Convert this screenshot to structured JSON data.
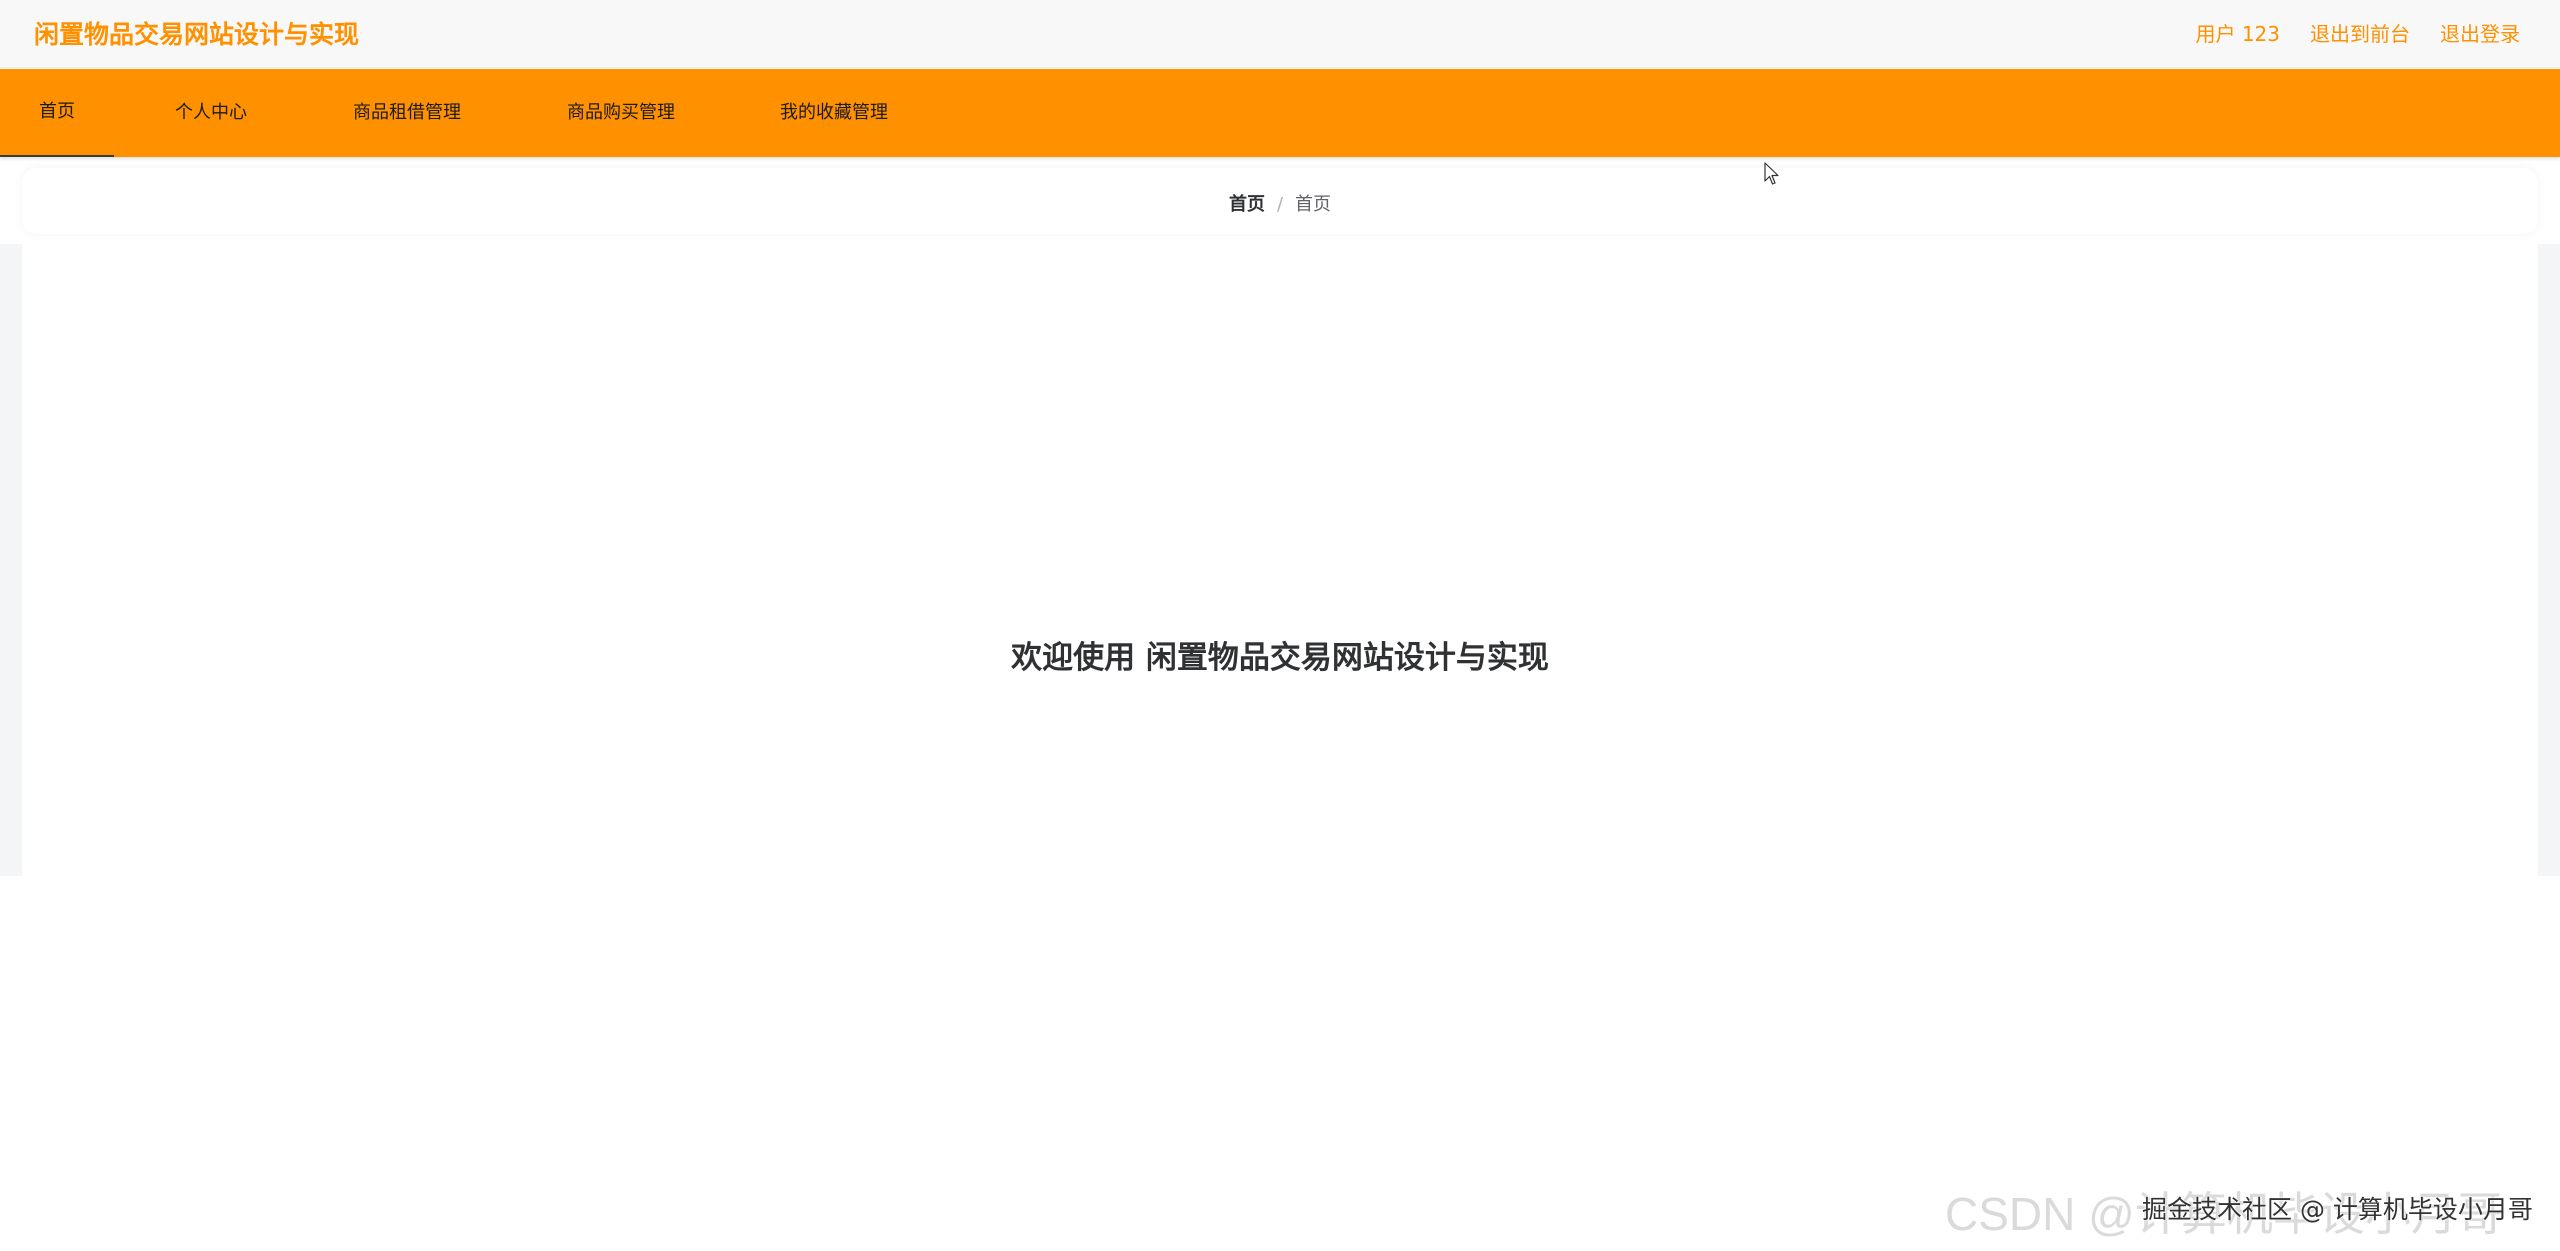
{
  "header": {
    "site_title": "闲置物品交易网站设计与实现",
    "user_label": "用户 123",
    "back_to_front": "退出到前台",
    "logout": "退出登录"
  },
  "nav": {
    "items": [
      {
        "label": "首页",
        "active": true
      },
      {
        "label": "个人中心"
      },
      {
        "label": "商品租借管理"
      },
      {
        "label": "商品购买管理"
      },
      {
        "label": "我的收藏管理"
      }
    ]
  },
  "breadcrumb": {
    "home": "首页",
    "separator": "/",
    "current": "首页"
  },
  "main": {
    "welcome": "欢迎使用 闲置物品交易网站设计与实现"
  },
  "watermark": {
    "csdn": "CSDN @计算机毕设小月哥",
    "juejin": "掘金技术社区 @ 计算机毕设小月哥"
  },
  "colors": {
    "accent": "#ff9000",
    "text_dark": "#303133",
    "page_bg": "#f4f5f7"
  },
  "icons": {
    "cursor": "mouse-pointer-icon"
  }
}
